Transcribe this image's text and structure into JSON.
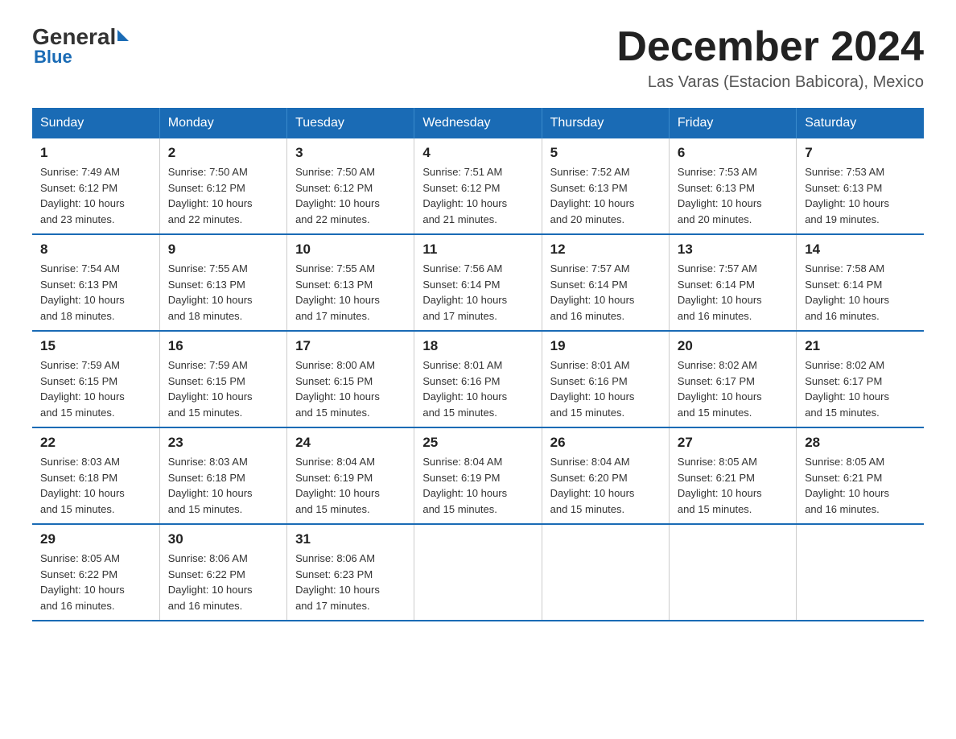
{
  "logo": {
    "general": "General",
    "triangle": "",
    "blue": "Blue"
  },
  "title": "December 2024",
  "location": "Las Varas (Estacion Babicora), Mexico",
  "days_of_week": [
    "Sunday",
    "Monday",
    "Tuesday",
    "Wednesday",
    "Thursday",
    "Friday",
    "Saturday"
  ],
  "weeks": [
    [
      {
        "day": "1",
        "sunrise": "7:49 AM",
        "sunset": "6:12 PM",
        "daylight": "10 hours and 23 minutes."
      },
      {
        "day": "2",
        "sunrise": "7:50 AM",
        "sunset": "6:12 PM",
        "daylight": "10 hours and 22 minutes."
      },
      {
        "day": "3",
        "sunrise": "7:50 AM",
        "sunset": "6:12 PM",
        "daylight": "10 hours and 22 minutes."
      },
      {
        "day": "4",
        "sunrise": "7:51 AM",
        "sunset": "6:12 PM",
        "daylight": "10 hours and 21 minutes."
      },
      {
        "day": "5",
        "sunrise": "7:52 AM",
        "sunset": "6:13 PM",
        "daylight": "10 hours and 20 minutes."
      },
      {
        "day": "6",
        "sunrise": "7:53 AM",
        "sunset": "6:13 PM",
        "daylight": "10 hours and 20 minutes."
      },
      {
        "day": "7",
        "sunrise": "7:53 AM",
        "sunset": "6:13 PM",
        "daylight": "10 hours and 19 minutes."
      }
    ],
    [
      {
        "day": "8",
        "sunrise": "7:54 AM",
        "sunset": "6:13 PM",
        "daylight": "10 hours and 18 minutes."
      },
      {
        "day": "9",
        "sunrise": "7:55 AM",
        "sunset": "6:13 PM",
        "daylight": "10 hours and 18 minutes."
      },
      {
        "day": "10",
        "sunrise": "7:55 AM",
        "sunset": "6:13 PM",
        "daylight": "10 hours and 17 minutes."
      },
      {
        "day": "11",
        "sunrise": "7:56 AM",
        "sunset": "6:14 PM",
        "daylight": "10 hours and 17 minutes."
      },
      {
        "day": "12",
        "sunrise": "7:57 AM",
        "sunset": "6:14 PM",
        "daylight": "10 hours and 16 minutes."
      },
      {
        "day": "13",
        "sunrise": "7:57 AM",
        "sunset": "6:14 PM",
        "daylight": "10 hours and 16 minutes."
      },
      {
        "day": "14",
        "sunrise": "7:58 AM",
        "sunset": "6:14 PM",
        "daylight": "10 hours and 16 minutes."
      }
    ],
    [
      {
        "day": "15",
        "sunrise": "7:59 AM",
        "sunset": "6:15 PM",
        "daylight": "10 hours and 15 minutes."
      },
      {
        "day": "16",
        "sunrise": "7:59 AM",
        "sunset": "6:15 PM",
        "daylight": "10 hours and 15 minutes."
      },
      {
        "day": "17",
        "sunrise": "8:00 AM",
        "sunset": "6:15 PM",
        "daylight": "10 hours and 15 minutes."
      },
      {
        "day": "18",
        "sunrise": "8:01 AM",
        "sunset": "6:16 PM",
        "daylight": "10 hours and 15 minutes."
      },
      {
        "day": "19",
        "sunrise": "8:01 AM",
        "sunset": "6:16 PM",
        "daylight": "10 hours and 15 minutes."
      },
      {
        "day": "20",
        "sunrise": "8:02 AM",
        "sunset": "6:17 PM",
        "daylight": "10 hours and 15 minutes."
      },
      {
        "day": "21",
        "sunrise": "8:02 AM",
        "sunset": "6:17 PM",
        "daylight": "10 hours and 15 minutes."
      }
    ],
    [
      {
        "day": "22",
        "sunrise": "8:03 AM",
        "sunset": "6:18 PM",
        "daylight": "10 hours and 15 minutes."
      },
      {
        "day": "23",
        "sunrise": "8:03 AM",
        "sunset": "6:18 PM",
        "daylight": "10 hours and 15 minutes."
      },
      {
        "day": "24",
        "sunrise": "8:04 AM",
        "sunset": "6:19 PM",
        "daylight": "10 hours and 15 minutes."
      },
      {
        "day": "25",
        "sunrise": "8:04 AM",
        "sunset": "6:19 PM",
        "daylight": "10 hours and 15 minutes."
      },
      {
        "day": "26",
        "sunrise": "8:04 AM",
        "sunset": "6:20 PM",
        "daylight": "10 hours and 15 minutes."
      },
      {
        "day": "27",
        "sunrise": "8:05 AM",
        "sunset": "6:21 PM",
        "daylight": "10 hours and 15 minutes."
      },
      {
        "day": "28",
        "sunrise": "8:05 AM",
        "sunset": "6:21 PM",
        "daylight": "10 hours and 16 minutes."
      }
    ],
    [
      {
        "day": "29",
        "sunrise": "8:05 AM",
        "sunset": "6:22 PM",
        "daylight": "10 hours and 16 minutes."
      },
      {
        "day": "30",
        "sunrise": "8:06 AM",
        "sunset": "6:22 PM",
        "daylight": "10 hours and 16 minutes."
      },
      {
        "day": "31",
        "sunrise": "8:06 AM",
        "sunset": "6:23 PM",
        "daylight": "10 hours and 17 minutes."
      },
      null,
      null,
      null,
      null
    ]
  ],
  "labels": {
    "sunrise_prefix": "Sunrise: ",
    "sunset_prefix": "Sunset: ",
    "daylight_prefix": "Daylight: "
  }
}
